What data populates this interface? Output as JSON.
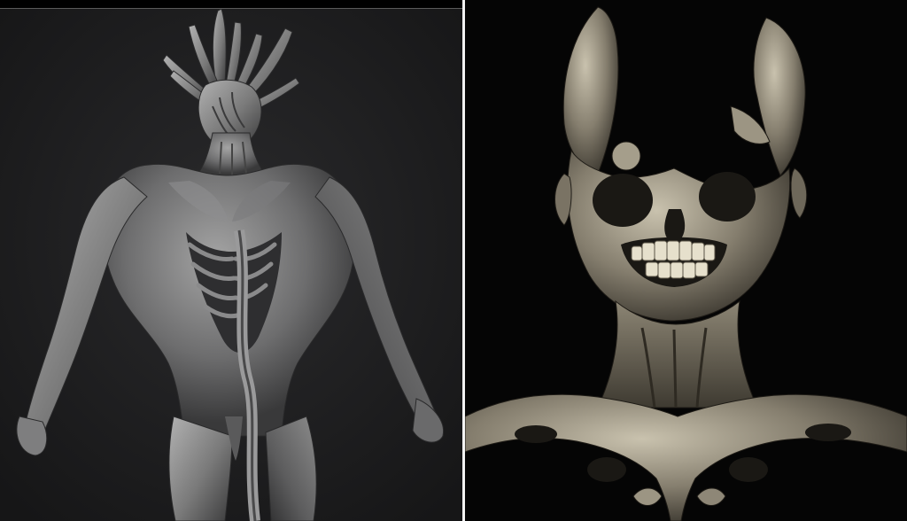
{
  "colors": {
    "left_background": "#1d1d1f",
    "right_background": "#050505",
    "divider": "#f2f2f2",
    "left_sculpt_light": "#a8a8a8",
    "left_sculpt_mid": "#6e6e6e",
    "left_sculpt_dark": "#2c2c2e",
    "right_sculpt_light": "#bfb8a6",
    "right_sculpt_mid": "#6f695c",
    "right_sculpt_dark": "#1a1814",
    "teeth": "#e6e0cc"
  }
}
